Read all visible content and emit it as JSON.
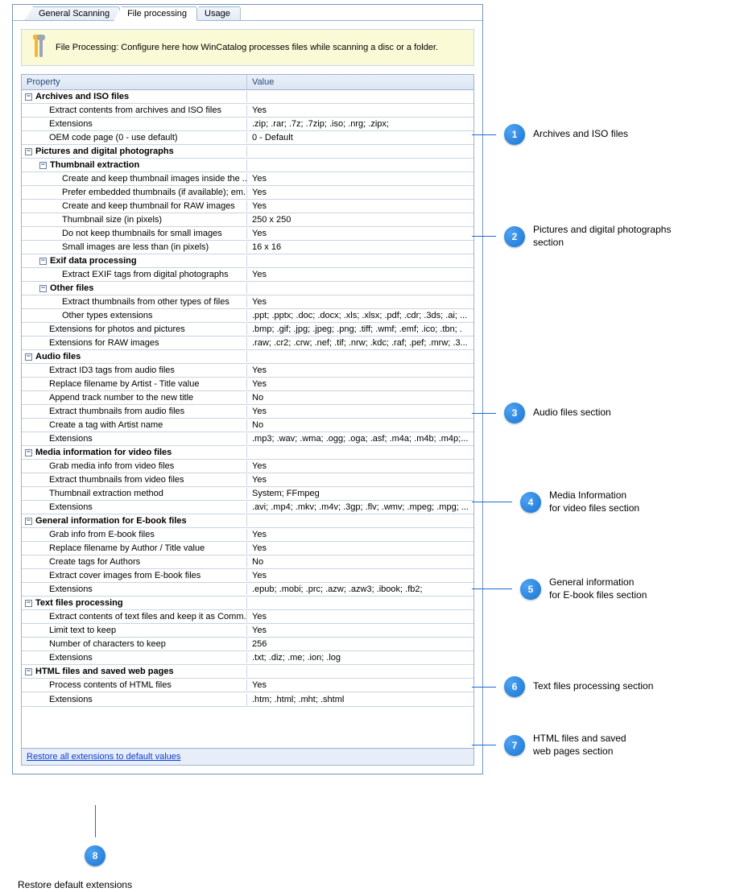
{
  "tabs": {
    "general": "General Scanning",
    "file": "File processing",
    "usage": "Usage"
  },
  "info": "File Processing: Configure here how WinCatalog processes files while scanning a disc or a folder.",
  "columns": {
    "prop": "Property",
    "val": "Value"
  },
  "restore": "Restore all extensions to default values",
  "sections": {
    "archives": {
      "title": "Archives and ISO files",
      "r1p": "Extract contents from archives and ISO files",
      "r1v": "Yes",
      "r2p": "Extensions",
      "r2v": ".zip; .rar; .7z; .7zip; .iso; .nrg; .zipx;",
      "r3p": "OEM code page (0 - use default)",
      "r3v": "0 - Default"
    },
    "pictures": {
      "title": "Pictures and digital photographs",
      "thumb_title": "Thumbnail extraction",
      "t1p": "Create and keep thumbnail images inside the ...",
      "t1v": "Yes",
      "t2p": "Prefer embedded thumbnails (if available); em...",
      "t2v": "Yes",
      "t3p": "Create and keep thumbnail for RAW images",
      "t3v": "Yes",
      "t4p": "Thumbnail size (in pixels)",
      "t4v": "250 x 250",
      "t5p": "Do not keep thumbnails for small images",
      "t5v": "Yes",
      "t6p": "Small images are less than (in pixels)",
      "t6v": "16 x 16",
      "exif_title": "Exif data processing",
      "e1p": "Extract EXIF tags from digital photographs",
      "e1v": "Yes",
      "other_title": "Other files",
      "o1p": "Extract thumbnails from other types of files",
      "o1v": "Yes",
      "o2p": "Other types extensions",
      "o2v": ".ppt; .pptx; .doc; .docx; .xls; .xlsx; .pdf; .cdr; .3ds; .ai; ...",
      "p1p": "Extensions for photos and pictures",
      "p1v": ".bmp; .gif; .jpg; .jpeg; .png; .tiff; .wmf; .emf; .ico; .tbn; .",
      "p2p": "Extensions for RAW images",
      "p2v": ".raw; .cr2; .crw; .nef; .tif; .nrw; .kdc; .raf; .pef; .mrw; .3..."
    },
    "audio": {
      "title": "Audio files",
      "a1p": "Extract ID3 tags from audio files",
      "a1v": "Yes",
      "a2p": "Replace filename by Artist - Title value",
      "a2v": "Yes",
      "a3p": "Append track number to the new title",
      "a3v": "No",
      "a4p": "Extract thumbnails from audio files",
      "a4v": "Yes",
      "a5p": "Create a tag with Artist name",
      "a5v": "No",
      "a6p": "Extensions",
      "a6v": ".mp3; .wav; .wma; .ogg; .oga; .asf; .m4a; .m4b; .m4p;..."
    },
    "video": {
      "title": "Media information for video files",
      "v1p": "Grab media info from video files",
      "v1v": "Yes",
      "v2p": "Extract thumbnails from video files",
      "v2v": "Yes",
      "v3p": "Thumbnail extraction method",
      "v3v": "System; FFmpeg",
      "v4p": "Extensions",
      "v4v": ".avi; .mp4; .mkv; .m4v; .3gp; .flv; .wmv; .mpeg; .mpg; ..."
    },
    "ebook": {
      "title": "General information for E-book files",
      "b1p": "Grab info from E-book files",
      "b1v": "Yes",
      "b2p": "Replace filename by Author / Title value",
      "b2v": "Yes",
      "b3p": "Create tags for Authors",
      "b3v": "No",
      "b4p": "Extract cover images from E-book files",
      "b4v": "Yes",
      "b5p": "Extensions",
      "b5v": ".epub; .mobi; .prc; .azw; .azw3; .ibook; .fb2;"
    },
    "text": {
      "title": "Text files processing",
      "x1p": "Extract contents of text files and keep it as Comm...",
      "x1v": "Yes",
      "x2p": "Limit text to keep",
      "x2v": "Yes",
      "x3p": "Number of characters to keep",
      "x3v": "256",
      "x4p": "Extensions",
      "x4v": ".txt; .diz; .me; .ion; .log"
    },
    "html": {
      "title": "HTML files and saved web pages",
      "h1p": "Process contents of HTML files",
      "h1v": "Yes",
      "h2p": "Extensions",
      "h2v": ".htm; .html; .mht; .shtml"
    }
  },
  "callouts": {
    "c1": "Archives and ISO files",
    "c2": "Pictures and digital photographs section",
    "c3": "Audio files section",
    "c4": "Media Information\nfor video files section",
    "c5": "General information\nfor E-book files section",
    "c6": "Text files processing section",
    "c7": "HTML files and saved\nweb pages section",
    "c8": "Restore default extensions"
  }
}
